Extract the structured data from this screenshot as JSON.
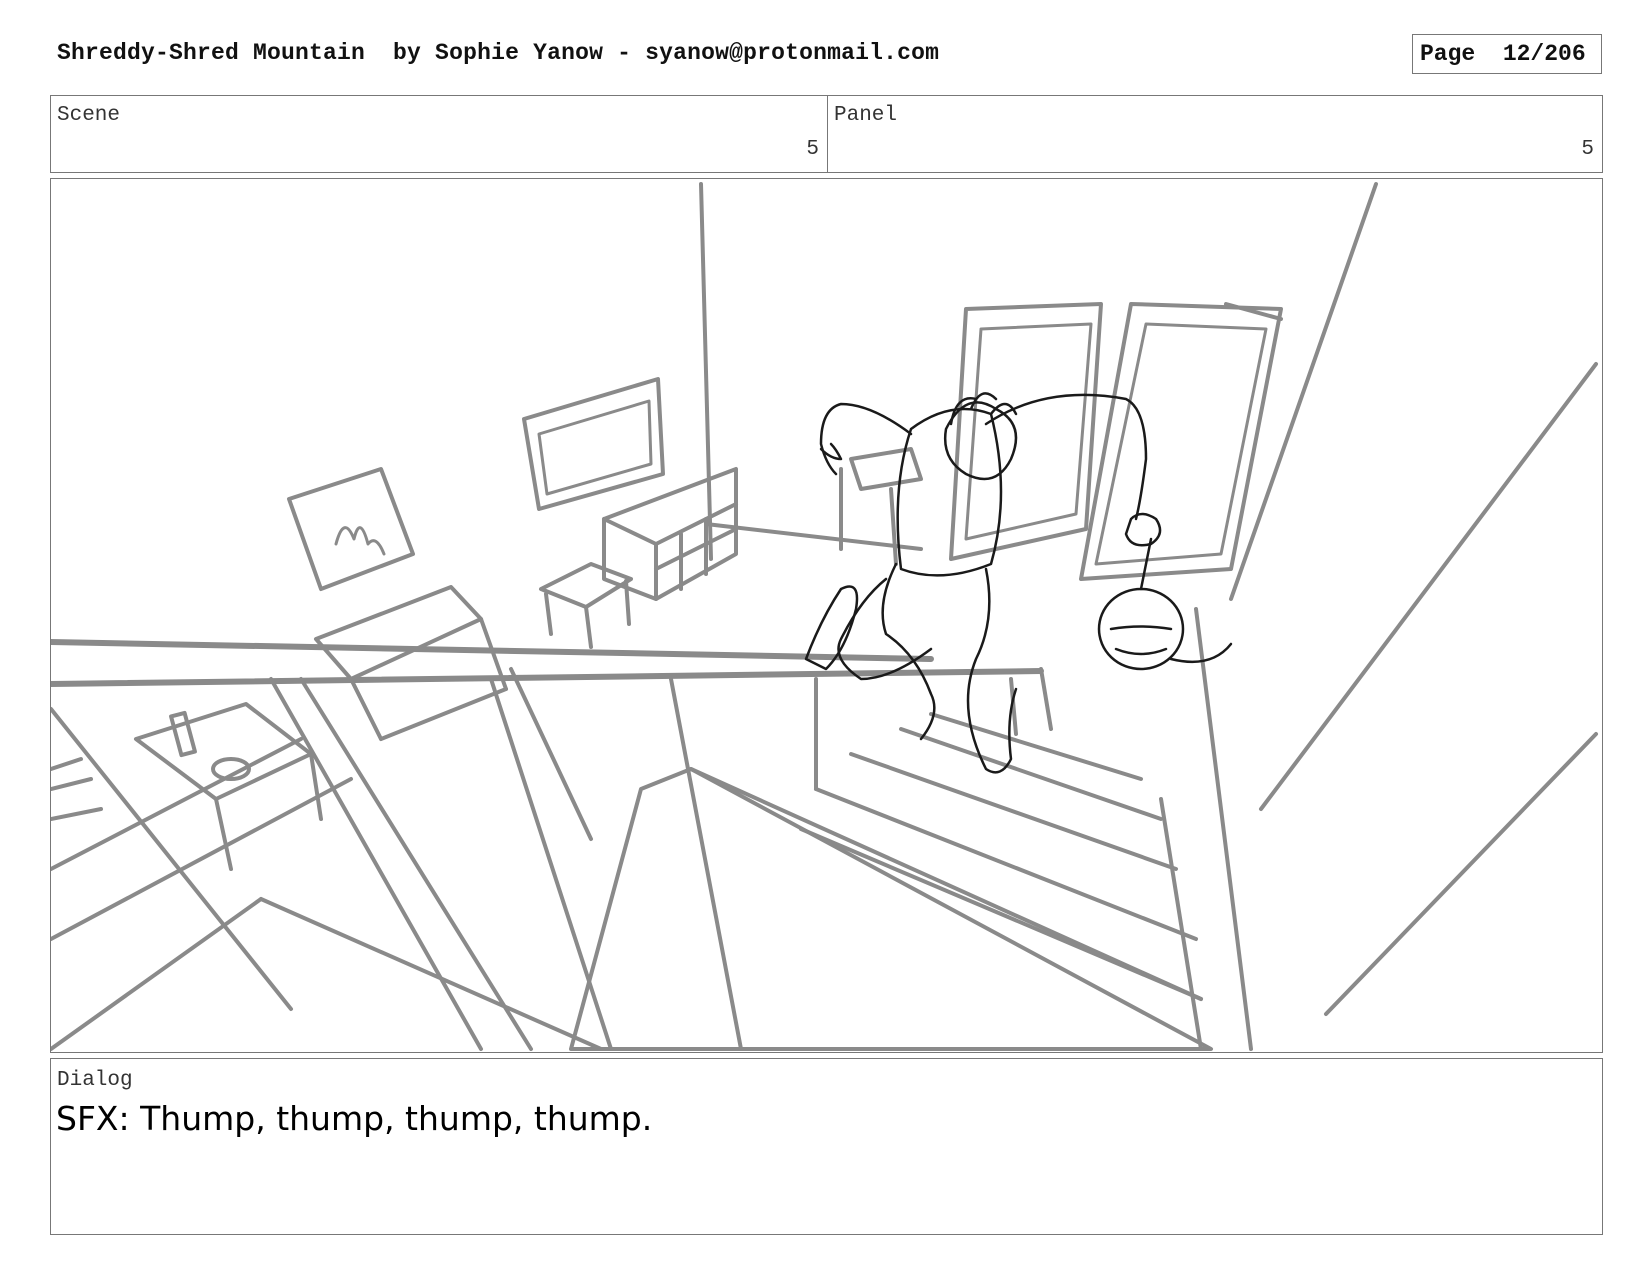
{
  "header": {
    "title": "Shreddy-Shred Mountain  by Sophie Yanow - syanow@protonmail.com",
    "page": "Page  12/206"
  },
  "info": {
    "scene_label": "Scene",
    "scene_value": "5",
    "panel_label": "Panel",
    "panel_value": "5"
  },
  "frame": {
    "description_icon": "storyboard-sketch"
  },
  "dialog": {
    "label": "Dialog",
    "text": "SFX: Thump, thump, thump, thump."
  },
  "colors": {
    "border": "#777777",
    "sketch_gray": "#8a8a8a",
    "sketch_dark": "#1a1a1a"
  }
}
